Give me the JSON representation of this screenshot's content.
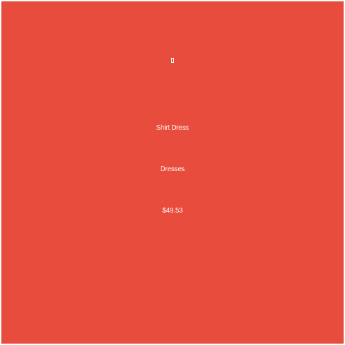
{
  "product": {
    "icon": "missing-glyph-icon",
    "name": "Shirt Dress",
    "category": "Dresses",
    "price": "$49.53"
  },
  "colors": {
    "card_background": "#e84c3d",
    "text": "#ffffff"
  }
}
